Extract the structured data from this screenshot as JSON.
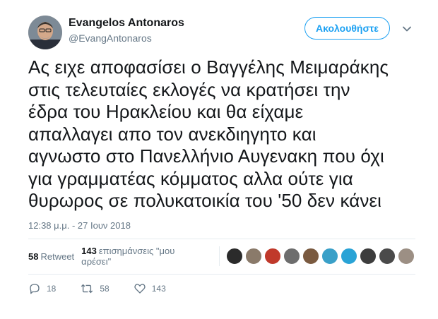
{
  "author": {
    "display_name": "Evangelos Antonaros",
    "handle": "@EvangAntonaros",
    "avatar_icon": "profile-photo"
  },
  "follow_button": {
    "label": "Ακολουθήστε",
    "color": "#1da1f2"
  },
  "tweet": {
    "text": "Ας ειχε αποφασίσει ο Βαγγέλης Μειμαράκης\nστις τελευταίες εκλογές να κρατήσει την\nέδρα του Ηρακλείου και θα είχαμε\nαπαλλαγει απο τον ανεκδιηγητο και\nαγνωστο στο Πανελλήνιο Αυγενακη που όχι\nγια γραμματέας κόμματος αλλα ούτε για\nθυρωρος σε πολυκατοικία του '50 δεν κάνει",
    "timestamp": "12:38 μ.μ. - 27 Ιουν 2018"
  },
  "stats": {
    "retweets_count": "58",
    "retweets_label": "Retweet",
    "likes_count": "143",
    "likes_label": "επισημάνσεις \"μου αρέσει\""
  },
  "likers": [
    {
      "color": "#2b2b2b"
    },
    {
      "color": "#8a7a6a"
    },
    {
      "color": "#c0392b"
    },
    {
      "color": "#6d6d6d"
    },
    {
      "color": "#7a5a40"
    },
    {
      "color": "#3aa0c8"
    },
    {
      "color": "#29a3d6"
    },
    {
      "color": "#3d3d3d"
    },
    {
      "color": "#4a4a4a"
    },
    {
      "color": "#9c8f84"
    }
  ],
  "actions": {
    "reply_count": "18",
    "retweet_count": "58",
    "like_count": "143"
  }
}
